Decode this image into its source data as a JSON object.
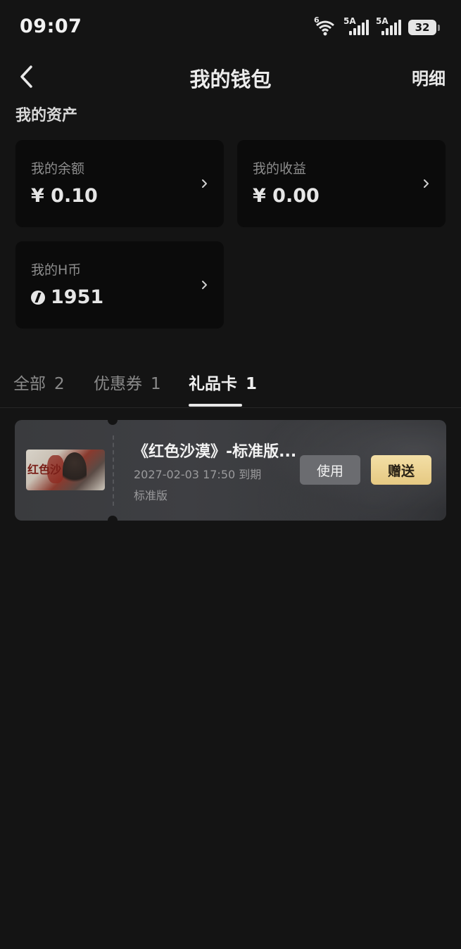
{
  "status_bar": {
    "time": "09:07",
    "wifi_label": "6",
    "signal1_label": "5A",
    "signal2_label": "5A",
    "battery": "32"
  },
  "header": {
    "title": "我的钱包",
    "detail_label": "明细",
    "back_icon": "chevron-left-icon"
  },
  "assets": {
    "section_title": "我的资产",
    "balance": {
      "label": "我的余额",
      "value": "¥ 0.10"
    },
    "earnings": {
      "label": "我的收益",
      "value": "¥ 0.00"
    },
    "hcoin": {
      "label": "我的H币",
      "value": "1951"
    }
  },
  "tabs": [
    {
      "label": "全部",
      "count": "2"
    },
    {
      "label": "优惠券",
      "count": "1"
    },
    {
      "label": "礼品卡",
      "count": "1",
      "active": true
    }
  ],
  "gift_card": {
    "thumb_text": "红色沙",
    "title": "《红色沙漠》-标准版...",
    "expiry": "2027-02-03 17:50 到期",
    "version": "标准版",
    "use_label": "使用",
    "gift_label": "赠送"
  },
  "colors": {
    "background": "#141414",
    "card": "#0b0b0b",
    "gift_button": "#f3dfa6"
  }
}
